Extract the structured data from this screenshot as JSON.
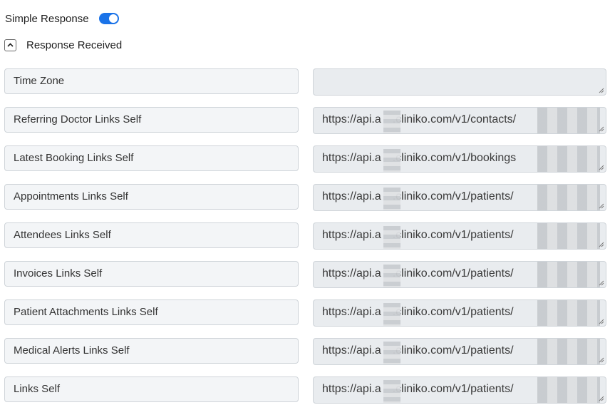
{
  "toggle": {
    "label": "Simple Response",
    "enabled": true,
    "accent_color": "#1a73e8"
  },
  "section": {
    "title": "Response Received",
    "collapse_icon": "chevron-up-icon"
  },
  "fields": [
    {
      "label": "Time Zone",
      "value": ""
    },
    {
      "label": "Referring Doctor Links Self",
      "value": "https://api.a██.cliniko.com/v1/contacts/"
    },
    {
      "label": "Latest Booking Links Self",
      "value": "https://api.a██.cliniko.com/v1/bookings"
    },
    {
      "label": "Appointments Links Self",
      "value": "https://api.a██.cliniko.com/v1/patients/"
    },
    {
      "label": "Attendees Links Self",
      "value": "https://api.a██.cliniko.com/v1/patients/"
    },
    {
      "label": "Invoices Links Self",
      "value": "https://api.a██.cliniko.com/v1/patients/"
    },
    {
      "label": "Patient Attachments Links Self",
      "value": "https://api.a██.cliniko.com/v1/patients/"
    },
    {
      "label": "Medical Alerts Links Self",
      "value": "https://api.a██.cliniko.com/v1/patients/"
    },
    {
      "label": "Links Self",
      "value": "https://api.a██.cliniko.com/v1/patients/"
    }
  ]
}
